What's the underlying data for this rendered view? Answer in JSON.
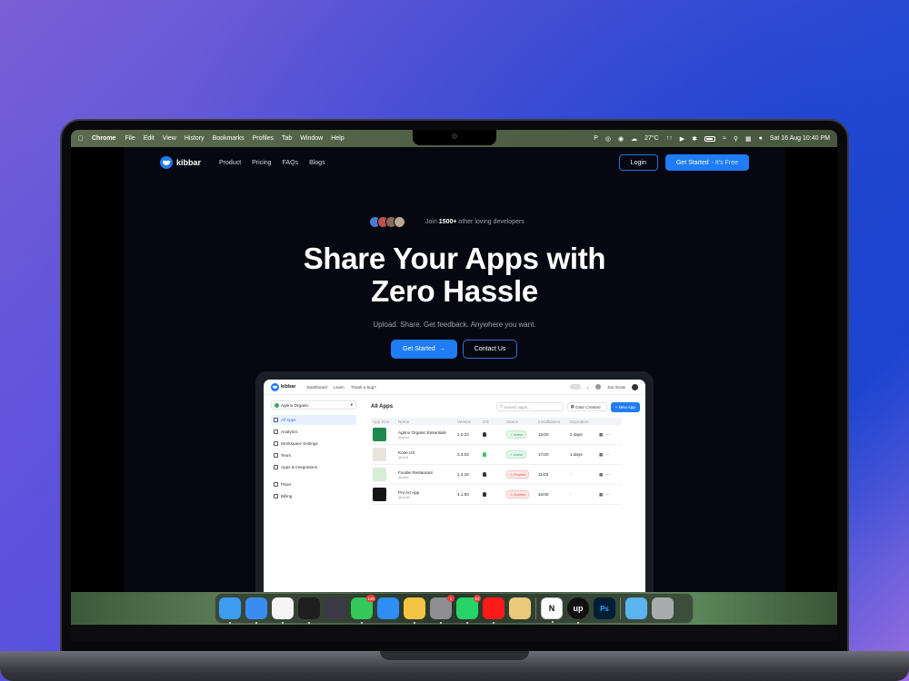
{
  "menubar": {
    "app_name": "Chrome",
    "items": [
      "File",
      "Edit",
      "View",
      "History",
      "Bookmarks",
      "Profiles",
      "Tab",
      "Window",
      "Help"
    ],
    "weather": "27°C",
    "datetime": "Sat 16 Aug  10:40 PM"
  },
  "site": {
    "logo_text": "kibbar",
    "nav_links": [
      "Product",
      "Pricing",
      "FAQs",
      "Blogs"
    ],
    "login_label": "Login",
    "get_started_label": "Get Started",
    "get_started_suffix": "- It's Free",
    "join_prefix": "Join",
    "join_count": "1500+",
    "join_suffix": "other loving developers",
    "hero_title_line1": "Share Your Apps with",
    "hero_title_line2": "Zero Hassle",
    "hero_subtitle": "Upload. Share. Get feedback. Anywhere you want.",
    "cta_primary": "Get Started",
    "cta_secondary": "Contact Us"
  },
  "mock": {
    "logo_text": "kibbar",
    "nav": [
      "Dashboard",
      "Learn",
      "Thank a bug?"
    ],
    "user": "Jon Snow",
    "workspace": "Agrino Organic",
    "sidebar": [
      "All Apps",
      "Analytics",
      "Workspace Settings",
      "Team",
      "Apps & Integrations"
    ],
    "sidebar_bottom": [
      "Plans",
      "Billing"
    ],
    "main_title": "All Apps",
    "search_placeholder": "Search apps...",
    "sort_label": "Date Created",
    "new_app_label": "+ New App",
    "columns": [
      "App Icon",
      "Name",
      "Version",
      "OS",
      "Status",
      "Installations",
      "Expiration",
      ""
    ],
    "rows": [
      {
        "name": "Agrino Organic Essentials",
        "owner": "@anne",
        "version": "1.0.24",
        "status": "Active",
        "installs": "12/20",
        "expiry": "2 days",
        "icon_color": "#1f8a50"
      },
      {
        "name": "Kone UX",
        "owner": "@rohit",
        "version": "2.3.02",
        "status": "Active",
        "installs": "17/20",
        "expiry": "1 days",
        "icon_color": "#e8e4dc"
      },
      {
        "name": "Foodie Restaurant",
        "owner": "@alice",
        "version": "1.3.16",
        "status": "Expired",
        "installs": "11/20",
        "expiry": "-",
        "icon_color": "#d8ecd6"
      },
      {
        "name": "Pro Art App",
        "owner": "@smith",
        "version": "4.1.00",
        "status": "Expired",
        "installs": "10/40",
        "expiry": "-",
        "icon_color": "#151515"
      }
    ]
  },
  "dock": {
    "apps": [
      {
        "name": "Finder",
        "color": "#3c9cf0",
        "badge": ""
      },
      {
        "name": "Safari",
        "color": "#3a8df0",
        "badge": ""
      },
      {
        "name": "Chrome",
        "color": "#f5f5f5",
        "badge": ""
      },
      {
        "name": "Figma",
        "color": "#1e1e1e",
        "badge": ""
      },
      {
        "name": "DaVinci Resolve",
        "color": "#3a3a46",
        "badge": ""
      },
      {
        "name": "Messages",
        "color": "#34c759",
        "badge": "126"
      },
      {
        "name": "Mail",
        "color": "#2f8ef6",
        "badge": ""
      },
      {
        "name": "Notes",
        "color": "#f4c542",
        "badge": ""
      },
      {
        "name": "System Settings",
        "color": "#8e8e93",
        "badge": "1"
      },
      {
        "name": "WhatsApp",
        "color": "#25d366",
        "badge": "52"
      },
      {
        "name": "YouTube Music",
        "color": "#ff1a1a",
        "badge": ""
      },
      {
        "name": "Ruler",
        "color": "#e9c97a",
        "badge": ""
      },
      {
        "name": "Notion",
        "color": "#ffffff",
        "badge": ""
      },
      {
        "name": "Upwork",
        "color": "#111111",
        "badge": ""
      },
      {
        "name": "Photoshop",
        "color": "#001e36",
        "badge": ""
      },
      {
        "name": "Folder",
        "color": "#5ab4f0",
        "badge": ""
      },
      {
        "name": "Trash",
        "color": "#a9abad",
        "badge": ""
      }
    ],
    "upwork_text": "up",
    "photoshop_text": "Ps",
    "notion_text": "N"
  }
}
